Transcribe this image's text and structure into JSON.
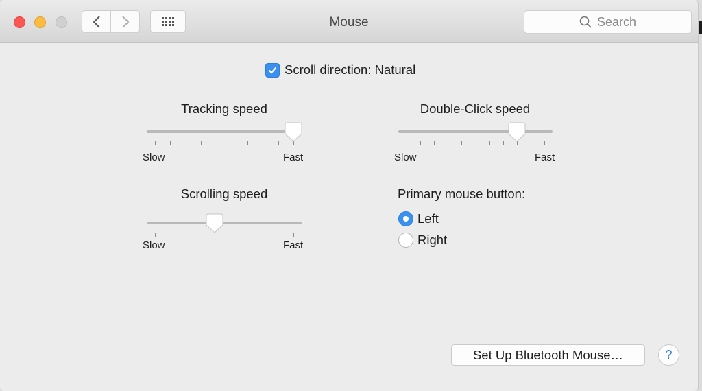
{
  "window": {
    "title": "Mouse",
    "search_placeholder": "Search"
  },
  "titlebar_icons": {
    "close": "close-button",
    "minimize": "minimize-button",
    "zoom": "zoom-button",
    "back": "chevron-left-icon",
    "forward": "chevron-right-icon",
    "show_all": "grid-icon",
    "search": "search-icon"
  },
  "scroll_direction": {
    "label": "Scroll direction: Natural",
    "checked": true
  },
  "tracking_speed": {
    "title": "Tracking speed",
    "min_label": "Slow",
    "max_label": "Fast",
    "tick_count": 10,
    "value_index": 9
  },
  "scrolling_speed": {
    "title": "Scrolling speed",
    "min_label": "Slow",
    "max_label": "Fast",
    "tick_count": 8,
    "value_index": 3
  },
  "double_click_speed": {
    "title": "Double-Click speed",
    "min_label": "Slow",
    "max_label": "Fast",
    "tick_count": 11,
    "value_index": 8
  },
  "primary_button": {
    "title": "Primary mouse button:",
    "options": [
      {
        "label": "Left",
        "selected": true
      },
      {
        "label": "Right",
        "selected": false
      }
    ]
  },
  "footer": {
    "bluetooth_button": "Set Up Bluetooth Mouse…",
    "help_button": "?"
  },
  "colors": {
    "accent": "#3b8fef",
    "close": "#fc5753",
    "minimize": "#fdbc40"
  }
}
